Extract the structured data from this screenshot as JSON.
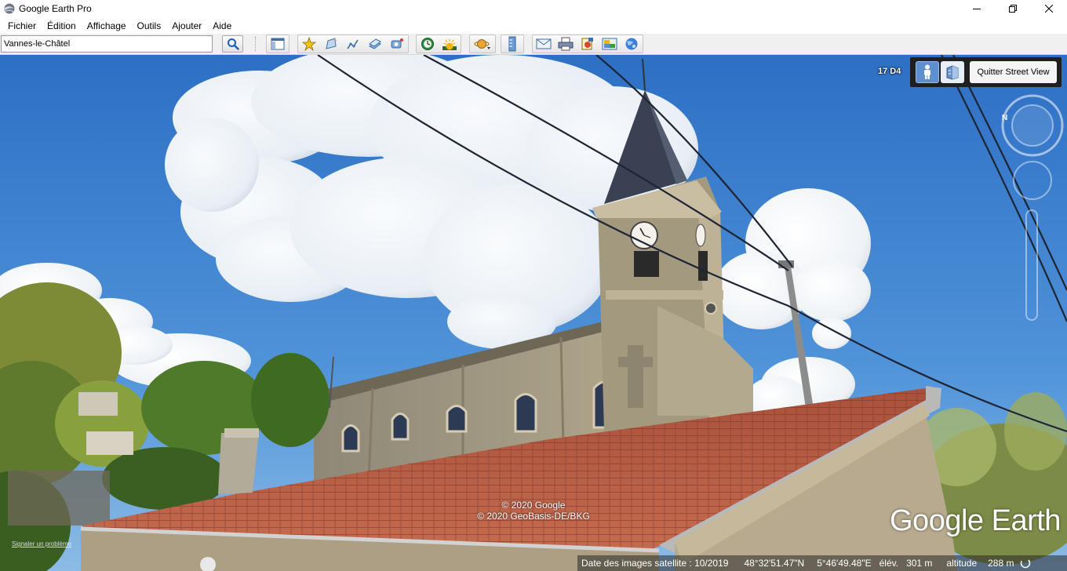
{
  "window": {
    "title": "Google Earth Pro"
  },
  "menu": {
    "items": [
      "Fichier",
      "Édition",
      "Affichage",
      "Outils",
      "Ajouter",
      "Aide"
    ]
  },
  "search": {
    "value": "Vannes-le-Châtel"
  },
  "toolbar": {
    "groups": [
      [
        "sidebar-icon"
      ],
      [
        "placemark-icon",
        "polygon-icon",
        "path-icon",
        "overlay-icon",
        "record-tour-icon"
      ],
      [
        "historical-imagery-icon",
        "sunlight-icon"
      ],
      [
        "planets-icon"
      ],
      [
        "ruler-icon"
      ],
      [
        "email-icon",
        "print-icon",
        "save-image-icon",
        "map-icon",
        "google-maps-icon"
      ]
    ]
  },
  "streetview": {
    "zoom_code": "17 D4",
    "quit_label": "Quitter Street View"
  },
  "compass": {
    "north_label": "N"
  },
  "imagery": {
    "copyright_lines": [
      "© 2020 Google",
      "© 2020 GeoBasis-DE/BKG"
    ],
    "brand": "Google Earth",
    "report_link": "Signaler un problème"
  },
  "status": {
    "imagery_date": "Date des images satellite : 10/2019",
    "latitude": "48°32'51.47\"N",
    "longitude": "5°46'49.48\"E",
    "elevation": "élév.   301 m",
    "altitude_label": "altitude",
    "altitude_value": "288 m"
  },
  "colors": {
    "sky": "#3f84d2",
    "roof": "#b5543c",
    "stone": "#a49b86",
    "panel": "#1f1f1f",
    "active_button": "#5f8fce"
  }
}
